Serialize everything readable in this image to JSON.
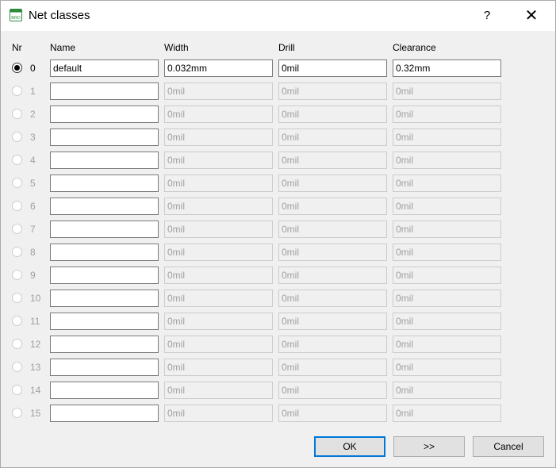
{
  "window": {
    "title": "Net classes",
    "help_label": "?",
    "close_label": "✕",
    "icon": "brd-file-icon",
    "icon_text": "BRD"
  },
  "headers": {
    "nr": "Nr",
    "name": "Name",
    "width": "Width",
    "drill": "Drill",
    "clearance": "Clearance"
  },
  "rows": [
    {
      "nr": "0",
      "selected": true,
      "enabled": true,
      "name": "default",
      "width": "0.032mm",
      "drill": "0mil",
      "clearance": "0.32mm"
    },
    {
      "nr": "1",
      "selected": false,
      "enabled": false,
      "name": "",
      "width": "0mil",
      "drill": "0mil",
      "clearance": "0mil"
    },
    {
      "nr": "2",
      "selected": false,
      "enabled": false,
      "name": "",
      "width": "0mil",
      "drill": "0mil",
      "clearance": "0mil"
    },
    {
      "nr": "3",
      "selected": false,
      "enabled": false,
      "name": "",
      "width": "0mil",
      "drill": "0mil",
      "clearance": "0mil"
    },
    {
      "nr": "4",
      "selected": false,
      "enabled": false,
      "name": "",
      "width": "0mil",
      "drill": "0mil",
      "clearance": "0mil"
    },
    {
      "nr": "5",
      "selected": false,
      "enabled": false,
      "name": "",
      "width": "0mil",
      "drill": "0mil",
      "clearance": "0mil"
    },
    {
      "nr": "6",
      "selected": false,
      "enabled": false,
      "name": "",
      "width": "0mil",
      "drill": "0mil",
      "clearance": "0mil"
    },
    {
      "nr": "7",
      "selected": false,
      "enabled": false,
      "name": "",
      "width": "0mil",
      "drill": "0mil",
      "clearance": "0mil"
    },
    {
      "nr": "8",
      "selected": false,
      "enabled": false,
      "name": "",
      "width": "0mil",
      "drill": "0mil",
      "clearance": "0mil"
    },
    {
      "nr": "9",
      "selected": false,
      "enabled": false,
      "name": "",
      "width": "0mil",
      "drill": "0mil",
      "clearance": "0mil"
    },
    {
      "nr": "10",
      "selected": false,
      "enabled": false,
      "name": "",
      "width": "0mil",
      "drill": "0mil",
      "clearance": "0mil"
    },
    {
      "nr": "11",
      "selected": false,
      "enabled": false,
      "name": "",
      "width": "0mil",
      "drill": "0mil",
      "clearance": "0mil"
    },
    {
      "nr": "12",
      "selected": false,
      "enabled": false,
      "name": "",
      "width": "0mil",
      "drill": "0mil",
      "clearance": "0mil"
    },
    {
      "nr": "13",
      "selected": false,
      "enabled": false,
      "name": "",
      "width": "0mil",
      "drill": "0mil",
      "clearance": "0mil"
    },
    {
      "nr": "14",
      "selected": false,
      "enabled": false,
      "name": "",
      "width": "0mil",
      "drill": "0mil",
      "clearance": "0mil"
    },
    {
      "nr": "15",
      "selected": false,
      "enabled": false,
      "name": "",
      "width": "0mil",
      "drill": "0mil",
      "clearance": "0mil"
    }
  ],
  "buttons": {
    "ok": "OK",
    "next": ">>",
    "cancel": "Cancel"
  },
  "colors": {
    "accent": "#0078d7",
    "disabled_text": "#a0a0a0",
    "dialog_bg": "#f0f0f0"
  }
}
